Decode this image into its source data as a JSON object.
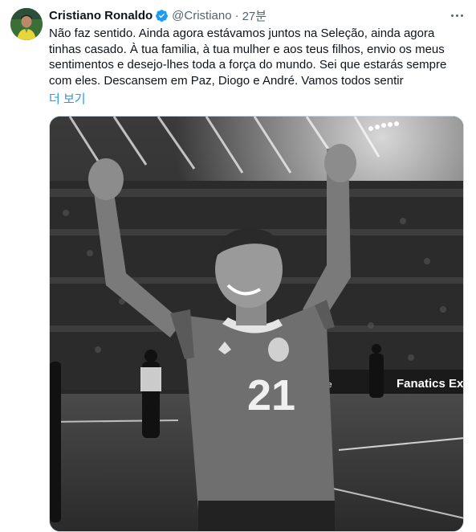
{
  "tweet": {
    "author_name": "Cristiano Ronaldo",
    "author_handle": "@Cristiano",
    "separator": "·",
    "timestamp": "27분",
    "verified": true,
    "text_lines": [
      "Não faz sentido. Ainda agora estávamos juntos na Seleção, ainda agora",
      "tinhas casado. À tua familia, à tua mulher e aos teus filhos, envio os meus",
      "sentimentos e desejo-lhes toda a força do mundo. Sei que estarás sempre",
      "com eles. Descansem em Paz, Diogo e André. Vamos todos sentir"
    ],
    "show_more_label": "더 보기"
  },
  "media": {
    "jersey_number": "21",
    "ad_board_text": "Fanatics Ex",
    "ad_board_left_text": "ce"
  },
  "colors": {
    "link": "#1d9bf0",
    "verified": "#1d9bf0",
    "secondary_text": "#536471",
    "primary_text": "#0f1419"
  },
  "icons": {
    "more": "more-dots-icon",
    "verified": "verified-badge-icon"
  }
}
